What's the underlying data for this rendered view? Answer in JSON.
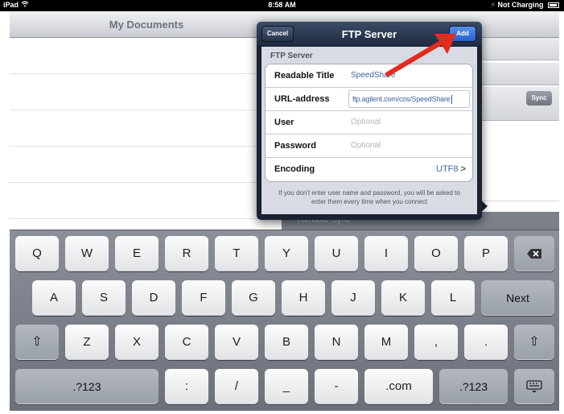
{
  "status_bar": {
    "device": "iPad",
    "wifi_icon": "wifi-icon",
    "time": "8:58 AM",
    "charging_icon": "charging-icon",
    "charging_text": "Not Charging"
  },
  "background": {
    "nav_title": "My Documents",
    "sync_label": "Sync",
    "remote_sync_label": "Remote Sync"
  },
  "popover": {
    "title": "FTP Server",
    "cancel_label": "Cancel",
    "add_label": "Add",
    "section_title": "FTP Server",
    "fields": [
      {
        "label": "Readable Title",
        "value": "SpeedShare",
        "placeholder": ""
      },
      {
        "label": "URL-address",
        "value": "ftp.agilent.com/cos/SpeedShare",
        "placeholder": ""
      },
      {
        "label": "User",
        "value": "",
        "placeholder": "Optional"
      },
      {
        "label": "Password",
        "value": "",
        "placeholder": "Optional"
      },
      {
        "label": "Encoding",
        "value": "UTF8",
        "placeholder": ""
      }
    ],
    "encoding_chevron": ">",
    "hint": "If you don't enter user name and password, you will be asked to enter them every time when you connect"
  },
  "keyboard": {
    "row1": [
      "Q",
      "W",
      "E",
      "R",
      "T",
      "Y",
      "U",
      "I",
      "O",
      "P"
    ],
    "row2": [
      "A",
      "S",
      "D",
      "F",
      "G",
      "H",
      "J",
      "K",
      "L"
    ],
    "row3": [
      "Z",
      "X",
      "C",
      "V",
      "B",
      "N",
      "M",
      ",",
      "."
    ],
    "return_label": "Next",
    "row4": [
      ".?123",
      ":",
      "/",
      "_",
      "-",
      ".com",
      ".?123"
    ],
    "backspace_icon": "backspace-icon",
    "shift_icon": "shift-icon",
    "hide_keyboard_icon": "hide-keyboard-icon"
  },
  "annotation": {
    "arrow_color": "#e32b1e"
  }
}
